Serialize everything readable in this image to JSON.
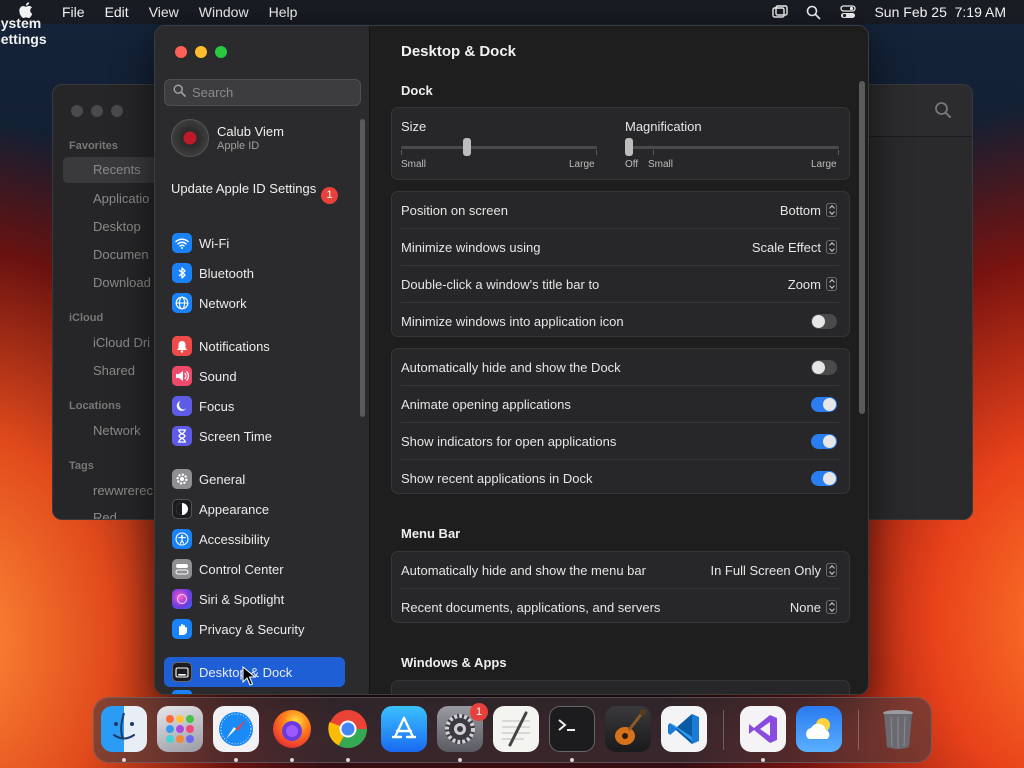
{
  "menubar": {
    "app_name": "System Settings",
    "items": [
      "File",
      "Edit",
      "View",
      "Window",
      "Help"
    ],
    "datetime": "Sun Feb 25  7:19 AM",
    "icons": [
      "apple-icon",
      "screen-mirroring-icon",
      "spotlight-search-icon",
      "control-center-icon"
    ]
  },
  "finder": {
    "sections": [
      "Favorites",
      "iCloud",
      "Locations",
      "Tags"
    ],
    "items": {
      "recents": "Recents",
      "applications": "Applicatio",
      "desktop": "Desktop",
      "documents": "Documen",
      "downloads": "Download",
      "icloud_drive": "iCloud Dri",
      "shared": "Shared",
      "network": "Network",
      "tag1": "rewwrerec",
      "tag2": "Red"
    }
  },
  "settings": {
    "search_placeholder": "Search",
    "account": {
      "name": "Calub Viem",
      "subtitle": "Apple ID"
    },
    "update": {
      "label": "Update Apple ID Settings",
      "badge": "1"
    },
    "sidebar": [
      {
        "id": "wifi",
        "label": "Wi-Fi",
        "color": "#1a82f7"
      },
      {
        "id": "bluetooth",
        "label": "Bluetooth",
        "color": "#1a82f7"
      },
      {
        "id": "network",
        "label": "Network",
        "color": "#1a82f7"
      },
      {
        "id": "notifications",
        "label": "Notifications",
        "color": "#ef4a4a"
      },
      {
        "id": "sound",
        "label": "Sound",
        "color": "#ef4a6a"
      },
      {
        "id": "focus",
        "label": "Focus",
        "color": "#5e5ce6"
      },
      {
        "id": "screen_time",
        "label": "Screen Time",
        "color": "#5e5ce6"
      },
      {
        "id": "general",
        "label": "General",
        "color": "#8e8e93"
      },
      {
        "id": "appearance",
        "label": "Appearance",
        "color": "#1c1c1e"
      },
      {
        "id": "accessibility",
        "label": "Accessibility",
        "color": "#1a82f7"
      },
      {
        "id": "control_center",
        "label": "Control Center",
        "color": "#8e8e93"
      },
      {
        "id": "siri_spotlight",
        "label": "Siri & Spotlight",
        "color": "#b03adf"
      },
      {
        "id": "privacy_security",
        "label": "Privacy & Security",
        "color": "#1a82f7"
      },
      {
        "id": "desktop_dock",
        "label": "Desktop & Dock",
        "color": "#1c1c1e"
      }
    ],
    "page_title": "Desktop & Dock",
    "dock_section": {
      "title": "Dock",
      "size": {
        "label": "Size",
        "min_label": "Small",
        "max_label": "Large",
        "value": 0.33
      },
      "magnification": {
        "label": "Magnification",
        "off_label": "Off",
        "min_label": "Small",
        "max_label": "Large",
        "value": 0.0
      },
      "position": {
        "label": "Position on screen",
        "value": "Bottom"
      },
      "minimize_using": {
        "label": "Minimize windows using",
        "value": "Scale Effect"
      },
      "double_click": {
        "label": "Double-click a window's title bar to",
        "value": "Zoom"
      },
      "minimize_into_icon": {
        "label": "Minimize windows into application icon",
        "on": false
      },
      "auto_hide": {
        "label": "Automatically hide and show the Dock",
        "on": false
      },
      "animate": {
        "label": "Animate opening applications",
        "on": true
      },
      "indicators": {
        "label": "Show indicators for open applications",
        "on": true
      },
      "recents": {
        "label": "Show recent applications in Dock",
        "on": true
      }
    },
    "menubar_section": {
      "title": "Menu Bar",
      "auto_hide": {
        "label": "Automatically hide and show the menu bar",
        "value": "In Full Screen Only"
      },
      "recent_docs": {
        "label": "Recent documents, applications, and servers",
        "value": "None"
      }
    },
    "windows_section": {
      "title": "Windows & Apps"
    }
  },
  "dock": {
    "apps": [
      "finder-icon",
      "launchpad-icon",
      "safari-icon",
      "firefox-icon",
      "chrome-icon",
      "app-store-icon",
      "system-settings-icon",
      "textedit-icon",
      "terminal-icon",
      "garageband-icon",
      "vscode-icon",
      "visual-studio-icon",
      "weather-icon",
      "trash-icon"
    ],
    "settings_badge": "1"
  }
}
